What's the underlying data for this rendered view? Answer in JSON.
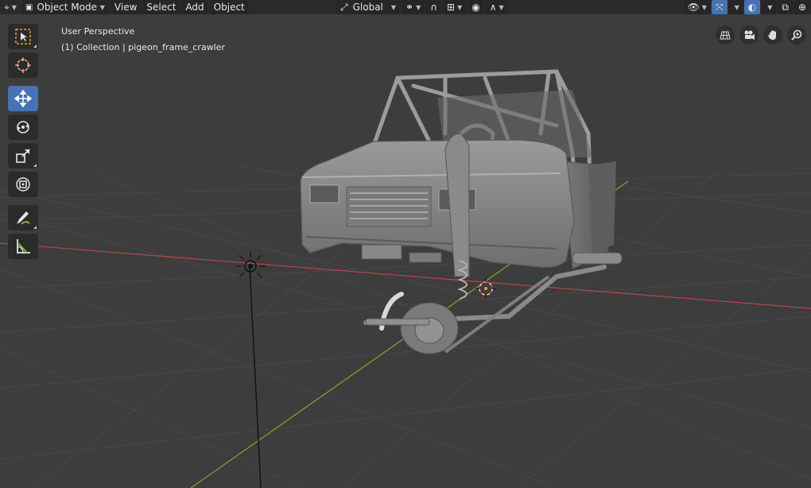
{
  "header": {
    "editor_type_icon": "3d-viewport-icon",
    "mode_select": "Object Mode",
    "menus": [
      "View",
      "Select",
      "Add",
      "Object"
    ],
    "transform_orientation": "Global",
    "pivot_icon": "pivot-icon",
    "snap_icon": "magnet-icon",
    "proportional_icon": "proportional-edit-icon",
    "right_icons": [
      "visibility-icon",
      "gizmo-icon",
      "overlay-icon",
      "xray-icon",
      "shading-wireframe-icon"
    ]
  },
  "viewport": {
    "view_name": "User Perspective",
    "collection_info": "(1) Collection | pigeon_frame_crawler",
    "object_name": "pigeon_frame_crawler"
  },
  "toolbar": {
    "tools": [
      {
        "name": "select-box",
        "icon": "select-box-icon",
        "active": false
      },
      {
        "name": "cursor",
        "icon": "cursor-icon",
        "active": false
      },
      {
        "name": "move",
        "icon": "move-icon",
        "active": true
      },
      {
        "name": "rotate",
        "icon": "rotate-icon",
        "active": false
      },
      {
        "name": "scale",
        "icon": "scale-icon",
        "active": false
      },
      {
        "name": "transform",
        "icon": "transform-icon",
        "active": false
      },
      {
        "name": "annotate",
        "icon": "annotate-icon",
        "active": false
      },
      {
        "name": "measure",
        "icon": "measure-icon",
        "active": false
      }
    ]
  },
  "nav_gizmo": [
    "grid-view-icon",
    "camera-icon",
    "hand-pan-icon",
    "zoom-icon"
  ],
  "colors": {
    "header_bg": "#2b2b2b",
    "viewport_bg": "#3d3d3d",
    "active_blue": "#4772b3",
    "x_axis": "#c8484e",
    "y_axis": "#7fa830",
    "model_gray": "#8a8a8a"
  }
}
